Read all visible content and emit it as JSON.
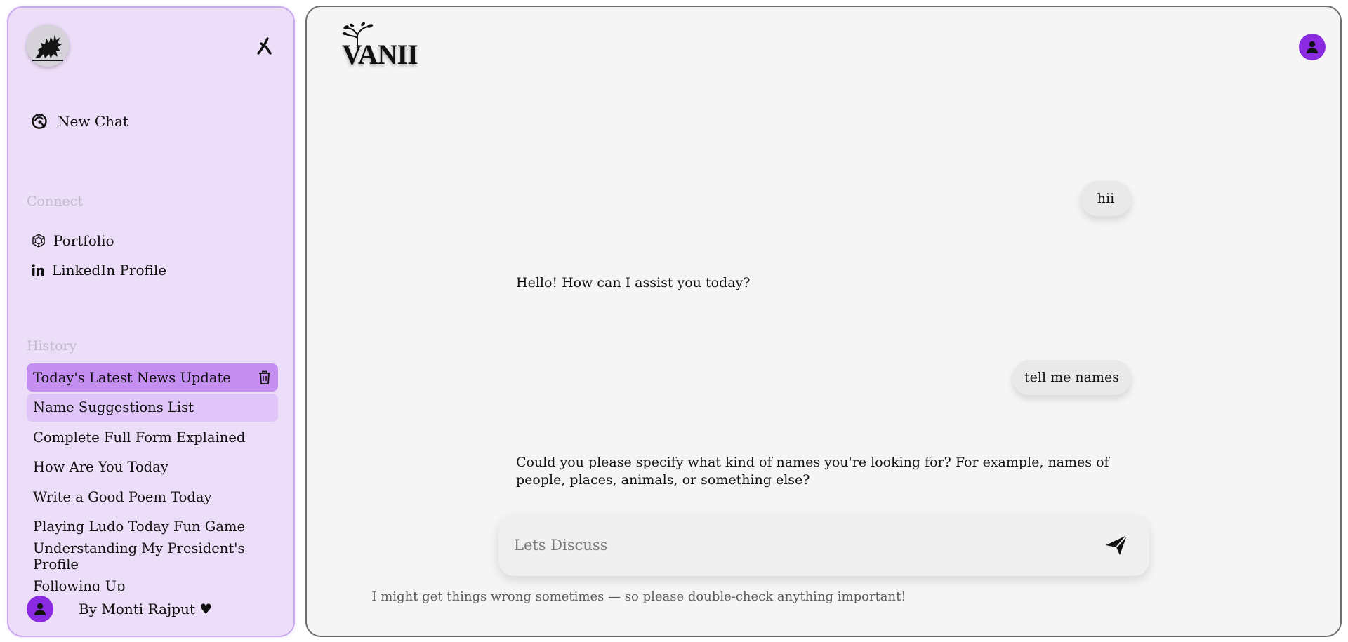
{
  "sidebar": {
    "new_chat_label": "New Chat",
    "connect_label": "Connect",
    "connect_items": [
      {
        "label": "Portfolio",
        "icon": "portfolio-icon"
      },
      {
        "label": "LinkedIn Profile",
        "icon": "linkedin-icon"
      }
    ],
    "history_label": "History",
    "history_items": [
      "Today's Latest News Update",
      "Name Suggestions List",
      "Complete Full Form Explained",
      "How Are You Today",
      "Write a Good Poem Today",
      "Playing Ludo Today Fun Game",
      "Understanding My President's Profile",
      "Following Up"
    ],
    "footer_text": "By Monti Rajput ♥"
  },
  "header": {
    "logo_text": "VANII"
  },
  "conversation": [
    {
      "role": "user",
      "text": "hii"
    },
    {
      "role": "assistant",
      "text": "Hello! How can I assist you today?"
    },
    {
      "role": "user",
      "text": "tell me names"
    },
    {
      "role": "assistant",
      "text": "Could you please specify what kind of names you're looking for? For example, names of people, places, animals, or something else?"
    }
  ],
  "composer": {
    "placeholder": "Lets Discuss",
    "value": ""
  },
  "disclaimer": "I might get things wrong sometimes — so please double-check anything important!",
  "colors": {
    "sidebar_bg": "#ecddf8",
    "sidebar_border": "#c9a8f0",
    "active_history": "#c48ff0",
    "hover_history": "#e0c6f8",
    "avatar": "#8a2be2",
    "main_bg": "#f5f5f5"
  }
}
